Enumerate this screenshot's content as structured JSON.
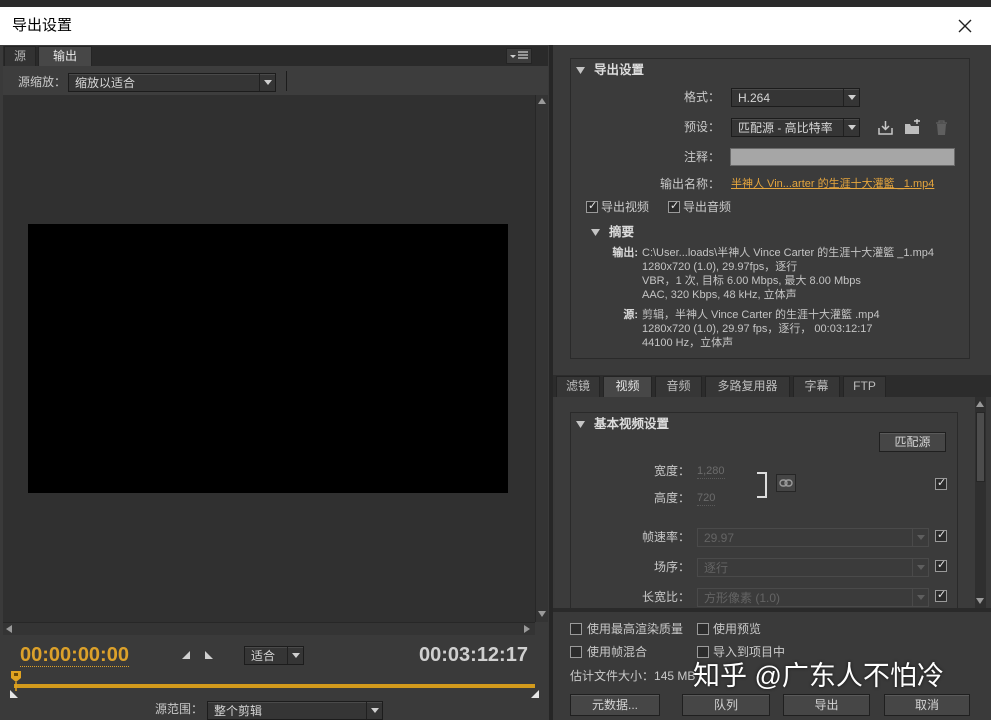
{
  "window": {
    "title": "导出设置"
  },
  "source_panel": {
    "tabs": [
      {
        "label": "源",
        "selected": false
      },
      {
        "label": "输出",
        "selected": true
      }
    ],
    "source_scaling": {
      "label": "源缩放：",
      "value": "缩放以适合"
    },
    "current_timecode": "00:00:00:00",
    "zoom": {
      "value": "适合"
    },
    "duration_timecode": "00:03:12:17",
    "playhead_progress": 0,
    "source_range": {
      "label": "源范围：",
      "value": "整个剪辑"
    }
  },
  "export_settings": {
    "header": "导出设置",
    "format": {
      "label": "格式：",
      "value": "H.264"
    },
    "preset": {
      "label": "预设：",
      "value": "匹配源 - 高比特率"
    },
    "comments": {
      "label": "注释：",
      "value": ""
    },
    "output_name": {
      "label": "输出名称：",
      "value": "半神人 Vin...arter 的生涯十大灌籃 _1.mp4"
    },
    "export_video": {
      "label": "导出视频",
      "checked": true
    },
    "export_audio": {
      "label": "导出音频",
      "checked": true
    },
    "summary": {
      "header": "摘要",
      "output_label": "输出:",
      "output_lines": [
        "C:\\User...loads\\半神人 Vince Carter 的生涯十大灌籃 _1.mp4",
        "1280x720 (1.0), 29.97fps，逐行",
        "VBR，1 次, 目标 6.00 Mbps, 最大 8.00 Mbps",
        "AAC, 320 Kbps, 48 kHz, 立体声"
      ],
      "source_label": "源:",
      "source_lines": [
        "剪辑，半神人 Vince Carter 的生涯十大灌籃 .mp4",
        "1280x720 (1.0), 29.97 fps，逐行， 00:03:12:17",
        "44100 Hz，立体声"
      ]
    }
  },
  "settings_tabs": [
    {
      "label": "滤镜",
      "selected": false
    },
    {
      "label": "视频",
      "selected": true
    },
    {
      "label": "音频",
      "selected": false
    },
    {
      "label": "多路复用器",
      "selected": false
    },
    {
      "label": "字幕",
      "selected": false
    },
    {
      "label": "FTP",
      "selected": false
    }
  ],
  "video_settings": {
    "header": "基本视频设置",
    "match_source_label": "匹配源",
    "width": {
      "label": "宽度：",
      "value": "1,280"
    },
    "height": {
      "label": "高度：",
      "value": "720"
    },
    "dimensions_checked": true,
    "frame_rate": {
      "label": "帧速率：",
      "value": "29.97",
      "checked": true
    },
    "field_order": {
      "label": "场序：",
      "value": "逐行",
      "checked": true
    },
    "aspect": {
      "label": "长宽比：",
      "value": "方形像素 (1.0)",
      "checked": true
    }
  },
  "options": {
    "max_render_quality": {
      "label": "使用最高渲染质量",
      "checked": false
    },
    "use_previews": {
      "label": "使用预览",
      "checked": false
    },
    "frame_blending": {
      "label": "使用帧混合",
      "checked": false
    },
    "import_into_project": {
      "label": "导入到项目中",
      "checked": false
    }
  },
  "estimated_file_size": {
    "label": "估计文件大小：",
    "value": "145 MB"
  },
  "buttons": {
    "metadata": "元数据...",
    "queue": "队列",
    "export": "导出",
    "cancel": "取消"
  },
  "watermark": "知乎 @广东人不怕冷",
  "icons": {
    "close": "close-icon",
    "panel_menu": "panel-menu-icon",
    "disclosure": "triangle-down-icon",
    "save_preset": "save-preset-icon",
    "import_preset": "import-preset-icon",
    "delete_preset": "trash-icon",
    "constrain": "link-icon"
  },
  "colors": {
    "timecode_accent": "#dca12a",
    "link": "#e5a53d",
    "timeline_bar": "#d29a1c",
    "video_frame": "#000000"
  }
}
